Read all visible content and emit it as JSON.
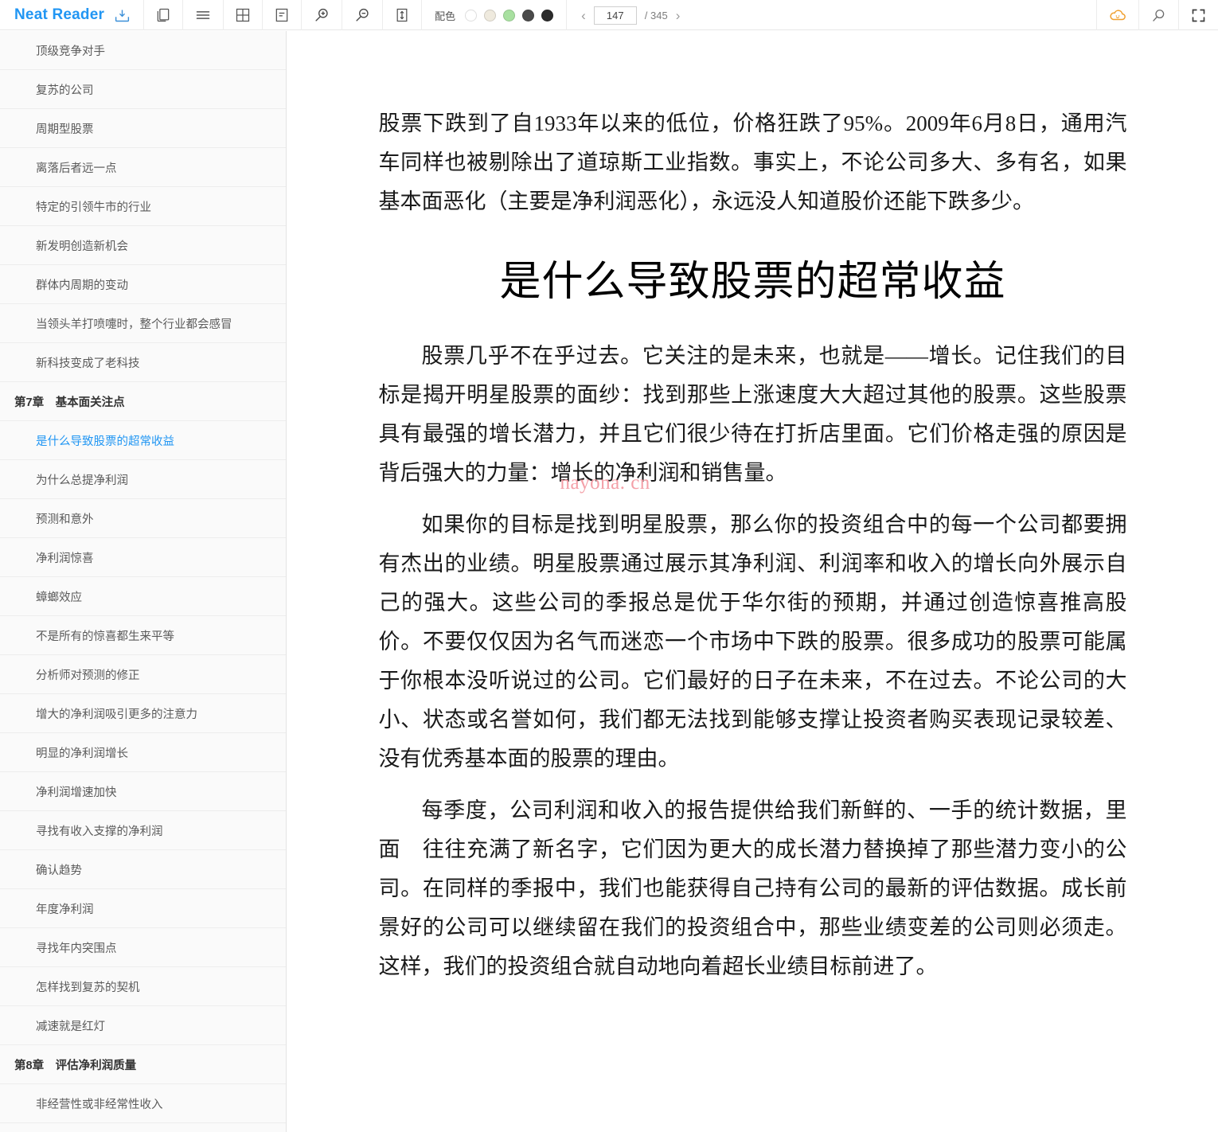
{
  "app": {
    "brand": "Neat Reader"
  },
  "toolbar": {
    "icons": [
      {
        "name": "download-book-icon",
        "glyph": "download"
      },
      {
        "name": "library-icon",
        "glyph": "books"
      },
      {
        "name": "toc-list-icon",
        "glyph": "hamburger"
      },
      {
        "name": "grid-view-icon",
        "glyph": "grid"
      },
      {
        "name": "notes-icon",
        "glyph": "note"
      },
      {
        "name": "zoom-in-icon",
        "glyph": "zoom-in"
      },
      {
        "name": "zoom-out-icon",
        "glyph": "zoom-out"
      },
      {
        "name": "line-height-icon",
        "glyph": "line-height"
      }
    ],
    "color_scheme": {
      "label": "配色",
      "swatches": [
        "#ffffff",
        "#efeade",
        "#a8e0a0",
        "#4a4a4a",
        "#2b2b2b"
      ],
      "selected_index": 0
    },
    "pagination": {
      "prev_label": "‹",
      "next_label": "›",
      "current_page": "147",
      "separator": "/ 345",
      "total_pages": "345"
    },
    "right_icons": [
      {
        "name": "cloud-sync-icon",
        "color": "#f0a030"
      },
      {
        "name": "search-icon",
        "color": "#6b6b6b"
      },
      {
        "name": "fullscreen-icon",
        "color": "#3d3d3d"
      }
    ]
  },
  "sidebar": {
    "items": [
      {
        "label": "顶级竞争对手",
        "type": "section",
        "active": false
      },
      {
        "label": "复苏的公司",
        "type": "section",
        "active": false
      },
      {
        "label": "周期型股票",
        "type": "section",
        "active": false
      },
      {
        "label": "离落后者远一点",
        "type": "section",
        "active": false
      },
      {
        "label": "特定的引领牛市的行业",
        "type": "section",
        "active": false
      },
      {
        "label": "新发明创造新机会",
        "type": "section",
        "active": false
      },
      {
        "label": "群体内周期的变动",
        "type": "section",
        "active": false
      },
      {
        "label": "当领头羊打喷嚏时，整个行业都会感冒",
        "type": "section",
        "active": false
      },
      {
        "label": "新科技变成了老科技",
        "type": "section",
        "active": false
      },
      {
        "label": "第7章　基本面关注点",
        "type": "chapter",
        "active": false
      },
      {
        "label": "是什么导致股票的超常收益",
        "type": "section",
        "active": true
      },
      {
        "label": "为什么总提净利润",
        "type": "section",
        "active": false
      },
      {
        "label": "预测和意外",
        "type": "section",
        "active": false
      },
      {
        "label": "净利润惊喜",
        "type": "section",
        "active": false
      },
      {
        "label": "蟑螂效应",
        "type": "section",
        "active": false
      },
      {
        "label": "不是所有的惊喜都生来平等",
        "type": "section",
        "active": false
      },
      {
        "label": "分析师对预测的修正",
        "type": "section",
        "active": false
      },
      {
        "label": "增大的净利润吸引更多的注意力",
        "type": "section",
        "active": false
      },
      {
        "label": "明显的净利润增长",
        "type": "section",
        "active": false
      },
      {
        "label": "净利润增速加快",
        "type": "section",
        "active": false
      },
      {
        "label": "寻找有收入支撑的净利润",
        "type": "section",
        "active": false
      },
      {
        "label": "确认趋势",
        "type": "section",
        "active": false
      },
      {
        "label": "年度净利润",
        "type": "section",
        "active": false
      },
      {
        "label": "寻找年内突围点",
        "type": "section",
        "active": false
      },
      {
        "label": "怎样找到复苏的契机",
        "type": "section",
        "active": false
      },
      {
        "label": "减速就是红灯",
        "type": "section",
        "active": false
      },
      {
        "label": "第8章　评估净利润质量",
        "type": "chapter",
        "active": false
      },
      {
        "label": "非经营性或非经常性收入",
        "type": "section",
        "active": false
      }
    ]
  },
  "content": {
    "paragraph_0": "股票下跌到了自1933年以来的低位，价格狂跌了95%。2009年6月8日，通用汽车同样也被剔除出了道琼斯工业指数。事实上，不论公司多大、多有名，如果基本面恶化（主要是净利润恶化），永远没人知道股价还能下跌多少。",
    "heading": "是什么导致股票的超常收益",
    "paragraph_1": "股票几乎不在乎过去。它关注的是未来，也就是——增长。记住我们的目标是揭开明星股票的面纱：找到那些上涨速度大大超过其他的股票。这些股票具有最强的增长潜力，并且它们很少待在打折店里面。它们价格走强的原因是背后强大的力量：增长的净利润和销售量。",
    "paragraph_2": "如果你的目标是找到明星股票，那么你的投资组合中的每一个公司都要拥有杰出的业绩。明星股票通过展示其净利润、利润率和收入的增长向外展示自己的强大。这些公司的季报总是优于华尔街的预期，并通过创造惊喜推高股价。不要仅仅因为名气而迷恋一个市场中下跌的股票。很多成功的股票可能属于你根本没听说过的公司。它们最好的日子在未来，不在过去。不论公司的大小、状态或名誉如何，我们都无法找到能够支撑让投资者购买表现记录较差、没有优秀基本面的股票的理由。",
    "paragraph_3": "每季度，公司利润和收入的报告提供给我们新鲜的、一手的统计数据，里面　往往充满了新名字，它们因为更大的成长潜力替换掉了那些潜力变小的公司。在同样的季报中，我们也能获得自己持有公司的最新的评估数据。成长前景好的公司可以继续留在我们的投资组合中，那些业绩变差的公司则必须走。这样，我们的投资组合就自动地向着超长业绩目标前进了。",
    "watermark": "nayona. cn"
  }
}
